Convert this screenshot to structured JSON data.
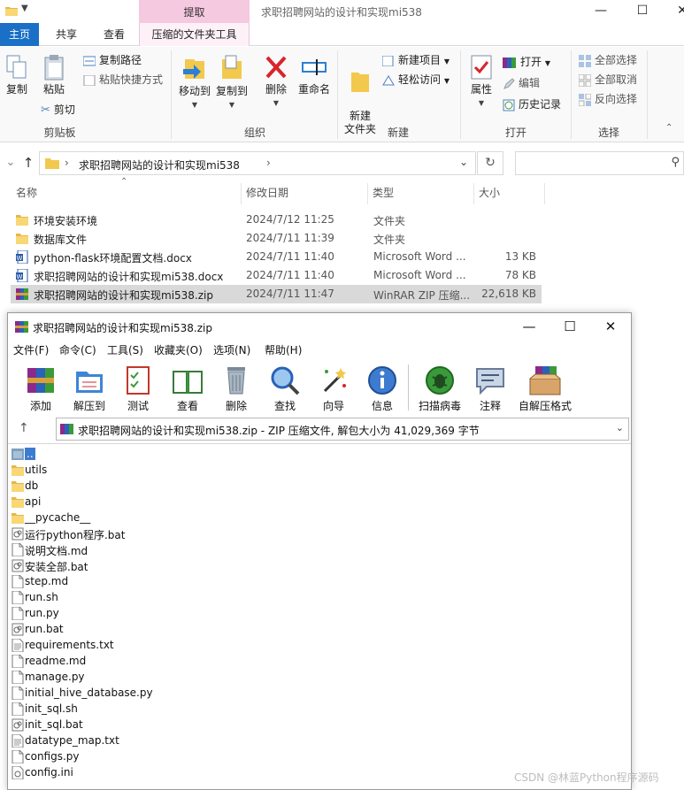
{
  "explorer": {
    "context_tab_head": "提取",
    "window_title": "求职招聘网站的设计和实现mi538",
    "tabs": [
      "主页",
      "共享",
      "查看",
      "压缩的文件夹工具"
    ],
    "ribbon": {
      "clipboard": {
        "copy": "复制",
        "paste": "粘贴",
        "copy_path": "复制路径",
        "paste_shortcut": "粘贴快捷方式",
        "cut": "剪切",
        "label": "剪贴板"
      },
      "organize": {
        "move_to": "移动到",
        "copy_to": "复制到",
        "delete": "删除",
        "rename": "重命名",
        "label": "组织"
      },
      "new": {
        "new_folder": "新建\n文件夹",
        "new_item": "新建项目",
        "easy_access": "轻松访问",
        "label": "新建"
      },
      "open": {
        "properties": "属性",
        "open": "打开",
        "edit": "编辑",
        "history": "历史记录",
        "label": "打开"
      },
      "select": {
        "select_all": "全部选择",
        "select_none": "全部取消",
        "invert": "反向选择",
        "label": "选择"
      }
    },
    "address": {
      "path": "求职招聘网站的设计和实现mi538"
    },
    "columns": {
      "name": "名称",
      "date": "修改日期",
      "type": "类型",
      "size": "大小"
    },
    "files": [
      {
        "name": "环境安装环境",
        "date": "2024/7/12 11:25",
        "type": "文件夹",
        "size": "",
        "icon": "folder-icon"
      },
      {
        "name": "数据库文件",
        "date": "2024/7/11 11:39",
        "type": "文件夹",
        "size": "",
        "icon": "folder-icon"
      },
      {
        "name": "python-flask环境配置文档.docx",
        "date": "2024/7/11 11:40",
        "type": "Microsoft Word ...",
        "size": "13 KB",
        "icon": "word-icon"
      },
      {
        "name": "求职招聘网站的设计和实现mi538.docx",
        "date": "2024/7/11 11:40",
        "type": "Microsoft Word ...",
        "size": "78 KB",
        "icon": "word-icon"
      },
      {
        "name": "求职招聘网站的设计和实现mi538.zip",
        "date": "2024/7/11 11:47",
        "type": "WinRAR ZIP 压缩...",
        "size": "22,618 KB",
        "icon": "winrar-icon"
      }
    ],
    "selected_index": 4
  },
  "rar": {
    "title": "求职招聘网站的设计和实现mi538.zip",
    "menus": [
      "文件(F)",
      "命令(C)",
      "工具(S)",
      "收藏夹(O)",
      "选项(N)",
      "帮助(H)"
    ],
    "toolbar": [
      "添加",
      "解压到",
      "测试",
      "查看",
      "删除",
      "查找",
      "向导",
      "信息",
      "扫描病毒",
      "注释",
      "自解压格式"
    ],
    "address": "求职招聘网站的设计和实现mi538.zip - ZIP 压缩文件, 解包大小为 41,029,369 字节",
    "entries": [
      {
        "name": "..",
        "icon": "parent-folder-icon"
      },
      {
        "name": "utils",
        "icon": "folder-icon"
      },
      {
        "name": "db",
        "icon": "folder-icon"
      },
      {
        "name": "api",
        "icon": "folder-icon"
      },
      {
        "name": "__pycache__",
        "icon": "folder-icon"
      },
      {
        "name": "运行python程序.bat",
        "icon": "bat-icon"
      },
      {
        "name": "说明文档.md",
        "icon": "file-icon"
      },
      {
        "name": "安装全部.bat",
        "icon": "bat-icon"
      },
      {
        "name": "step.md",
        "icon": "file-icon"
      },
      {
        "name": "run.sh",
        "icon": "file-icon"
      },
      {
        "name": "run.py",
        "icon": "file-icon"
      },
      {
        "name": "run.bat",
        "icon": "bat-icon"
      },
      {
        "name": "requirements.txt",
        "icon": "text-file-icon"
      },
      {
        "name": "readme.md",
        "icon": "file-icon"
      },
      {
        "name": "manage.py",
        "icon": "file-icon"
      },
      {
        "name": "initial_hive_database.py",
        "icon": "file-icon"
      },
      {
        "name": "init_sql.sh",
        "icon": "file-icon"
      },
      {
        "name": "init_sql.bat",
        "icon": "bat-icon"
      },
      {
        "name": "datatype_map.txt",
        "icon": "text-file-icon"
      },
      {
        "name": "configs.py",
        "icon": "file-icon"
      },
      {
        "name": "config.ini",
        "icon": "ini-icon"
      }
    ]
  },
  "watermark": "CSDN @林蓝Python程序源码"
}
